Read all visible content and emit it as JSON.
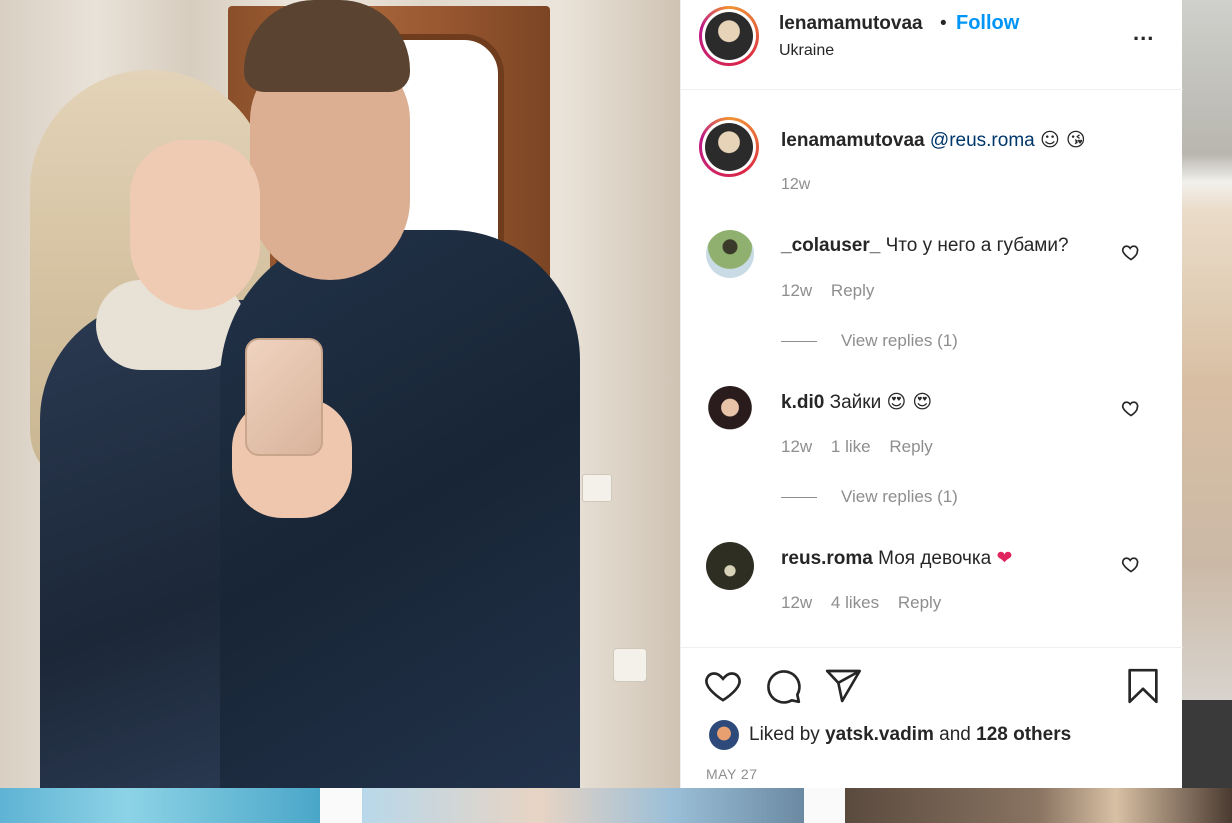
{
  "header": {
    "username": "lenamamutovaa",
    "dot": "•",
    "follow_label": "Follow",
    "location": "Ukraine",
    "more_label": "..."
  },
  "caption": {
    "username": "lenamamutovaa",
    "mention": "@reus.roma",
    "emojis": "☺ 😘",
    "time": "12w"
  },
  "comments": [
    {
      "username": "_colauser_",
      "text": "Что у него а губами?",
      "time": "12w",
      "likes": "",
      "reply_label": "Reply",
      "view_replies": "View replies (1)",
      "avatar_color": "#6a8f6e"
    },
    {
      "username": "k.di0",
      "text": "Зайки",
      "emoji": "😍 😍",
      "time": "12w",
      "likes": "1 like",
      "reply_label": "Reply",
      "view_replies": "View replies (1)",
      "avatar_color": "#3a2a2a"
    },
    {
      "username": "reus.roma",
      "text": "Моя девочка",
      "emoji": "❤",
      "time": "12w",
      "likes": "4 likes",
      "reply_label": "Reply",
      "avatar_color": "#2e2e22"
    }
  ],
  "likes": {
    "prefix": "Liked by",
    "user": "yatsk.vadim",
    "and": "and",
    "others": "128 others"
  },
  "date": "MAY 27",
  "icons": [
    "heart-icon",
    "comment-icon",
    "share-icon",
    "bookmark-icon",
    "more-icon"
  ]
}
